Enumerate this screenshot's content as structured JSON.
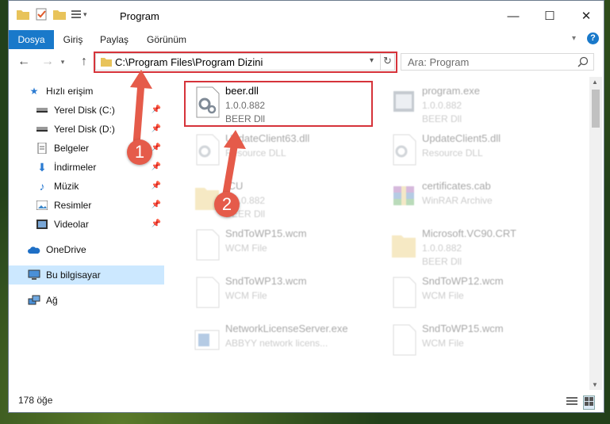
{
  "window": {
    "title": "Program",
    "ribbon_tabs": [
      "Dosya",
      "Giriş",
      "Paylaş",
      "Görünüm"
    ],
    "controls": {
      "minimize": "—",
      "maximize": "☐",
      "close": "✕"
    },
    "help_icon": "?"
  },
  "address": {
    "path": "C:\\Program Files\\Program Dizini",
    "search_placeholder": "Ara: Program"
  },
  "sidebar": {
    "items": [
      {
        "label": "Hızlı erişim",
        "icon": "star-icon"
      },
      {
        "label": "Yerel Disk (C:)",
        "icon": "drive-icon",
        "pinned": true
      },
      {
        "label": "Yerel Disk (D:)",
        "icon": "drive-icon",
        "pinned": true
      },
      {
        "label": "Belgeler",
        "icon": "document-icon",
        "pinned": true
      },
      {
        "label": "İndirmeler",
        "icon": "download-icon",
        "pinned": true
      },
      {
        "label": "Müzik",
        "icon": "music-icon",
        "pinned": true
      },
      {
        "label": "Resimler",
        "icon": "pictures-icon",
        "pinned": true
      },
      {
        "label": "Videolar",
        "icon": "video-icon",
        "pinned": true
      },
      {
        "label": "OneDrive",
        "icon": "cloud-icon"
      },
      {
        "label": "Bu bilgisayar",
        "icon": "computer-icon",
        "selected": true
      },
      {
        "label": "Ağ",
        "icon": "network-icon"
      }
    ]
  },
  "files": [
    {
      "name": "beer.dll",
      "line2": "1.0.0.882",
      "line3": "BEER Dll",
      "highlight": true
    },
    {
      "name": "program.exe",
      "line2": "1.0.0.882",
      "line3": "BEER Dll"
    },
    {
      "name": "UpdateClient63.dll",
      "line2": "Resource DLL",
      "line3": ""
    },
    {
      "name": "UpdateClient5.dll",
      "line2": "Resource DLL",
      "line3": ""
    },
    {
      "name": "ICU",
      "line2": "1.0.0.882",
      "line3": "BEER Dll"
    },
    {
      "name": "certificates.cab",
      "line2": "WinRAR Archive",
      "line3": ""
    },
    {
      "name": "SndToWP15.wcm",
      "line2": "WCM File",
      "line3": ""
    },
    {
      "name": "Microsoft.VC90.CRT",
      "line2": "1.0.0.882",
      "line3": "BEER Dll"
    },
    {
      "name": "SndToWP13.wcm",
      "line2": "WCM File",
      "line3": ""
    },
    {
      "name": "SndToWP12.wcm",
      "line2": "WCM File",
      "line3": ""
    },
    {
      "name": "NetworkLicenseServer.exe",
      "line2": "ABBYY network licens...",
      "line3": ""
    },
    {
      "name": "SndToWP15.wcm",
      "line2": "WCM File",
      "line3": ""
    }
  ],
  "status": {
    "count": "178 öğe"
  },
  "annotations": {
    "step1": "1",
    "step2": "2"
  },
  "colors": {
    "accent": "#1979ca",
    "highlight": "#d6333a",
    "badge": "#e55b4a"
  }
}
